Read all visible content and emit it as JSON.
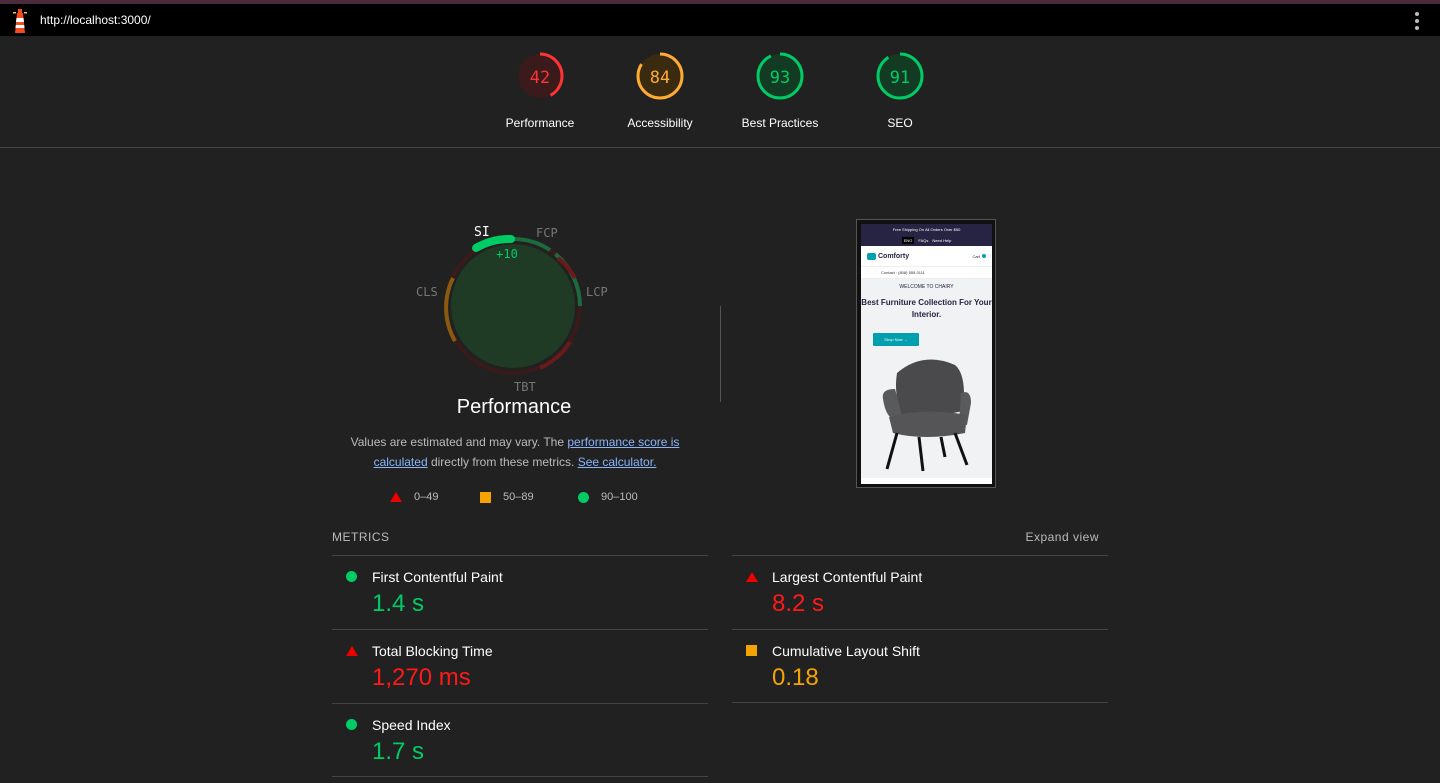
{
  "topbar": {
    "url": "http://localhost:3000/"
  },
  "scores": [
    {
      "label": "Performance",
      "score": "42",
      "fraction": 0.42,
      "color": "#ff3333",
      "bg": "#3a1a1a"
    },
    {
      "label": "Accessibility",
      "score": "84",
      "fraction": 0.84,
      "color": "#ffaa33",
      "bg": "#3a2a10"
    },
    {
      "label": "Best Practices",
      "score": "93",
      "fraction": 0.93,
      "color": "#00cc66",
      "bg": "#133a22"
    },
    {
      "label": "SEO",
      "score": "91",
      "fraction": 0.91,
      "color": "#00cc66",
      "bg": "#133a22"
    }
  ],
  "performance": {
    "title": "Performance",
    "si_delta": "+10",
    "metric_labels": {
      "si": "SI",
      "fcp": "FCP",
      "lcp": "LCP",
      "tbt": "TBT",
      "cls": "CLS"
    },
    "desc_1": "Values are estimated and may vary. The",
    "desc_link1": "performance score is calculated",
    "desc_2": "directly from these metrics.",
    "desc_link2": "See calculator.",
    "legend": {
      "fail": "0–49",
      "average": "50–89",
      "pass": "90–100"
    }
  },
  "screenshot": {
    "promo": "Free Shipping On All Orders Over $50",
    "lang": "ENG",
    "faqs": "FAQs",
    "help": "Need Help",
    "brand": "Comforty",
    "cart": "Cart",
    "contact": "Contact : (808) 555-0111",
    "welcome": "WELCOME TO CHAIRY",
    "headline": "Best Furniture Collection For Your Interior.",
    "cta": "Shop Now →"
  },
  "metrics": {
    "header": "METRICS",
    "expand": "Expand view",
    "fcp": {
      "name": "First Contentful Paint",
      "value": "1.4 s"
    },
    "lcp": {
      "name": "Largest Contentful Paint",
      "value": "8.2 s"
    },
    "tbt": {
      "name": "Total Blocking Time",
      "value": "1,270 ms"
    },
    "cls": {
      "name": "Cumulative Layout Shift",
      "value": "0.18"
    },
    "si": {
      "name": "Speed Index",
      "value": "1.7 s"
    }
  },
  "colors": {
    "pass": "#00cc66",
    "average": "#f5a300",
    "fail": "#ff1a1a"
  }
}
